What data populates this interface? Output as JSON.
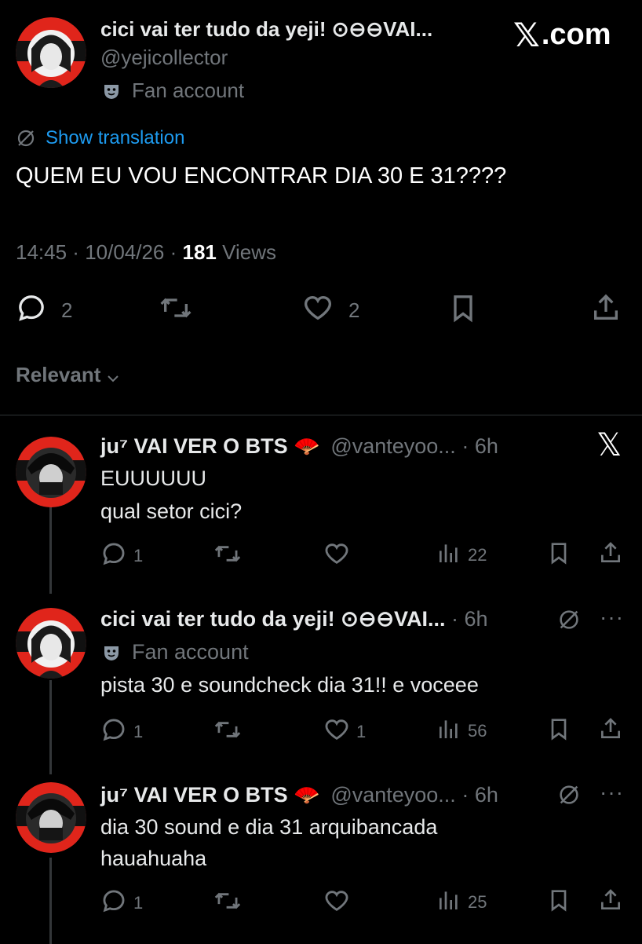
{
  "watermark": "X.com",
  "main_post": {
    "display_name": "cici vai ter tudo da yeji! ⊙⊖⊖VAI...",
    "handle": "@yejicollector",
    "badge": "Fan account",
    "translate_label": "Show translation",
    "text": "QUEM EU VOU ENCONTRAR DIA 30 E 31????",
    "time": "14:45",
    "date": "10/04/26",
    "views_count": "181",
    "views_label": "Views",
    "replies": "2",
    "likes": "2"
  },
  "sort_label": "Relevant",
  "replies": [
    {
      "display_name": "ju⁷ VAI VER O BTS 🪭",
      "handle": "@vanteyoo...",
      "time": "6h",
      "lines": [
        "EUUUUUU",
        "qual setor cici?"
      ],
      "reply_count": "1",
      "like_count": "",
      "view_count": "22"
    },
    {
      "display_name": "cici vai ter tudo da yeji! ⊙⊖⊖VAI...",
      "time": "6h",
      "badge": "Fan account",
      "lines": [
        "pista 30 e soundcheck dia 31!! e voceee"
      ],
      "reply_count": "1",
      "like_count": "1",
      "view_count": "56"
    },
    {
      "display_name": "ju⁷ VAI VER O BTS 🪭",
      "handle": "@vanteyoo...",
      "time": "6h",
      "lines": [
        "dia 30 sound e dia 31 arquibancada",
        "hauahuaha"
      ],
      "reply_count": "1",
      "like_count": "",
      "view_count": "25"
    }
  ],
  "colors": {
    "background": "#000000",
    "text": "#e7e9ea",
    "muted": "#71767b",
    "link": "#1d9bf0",
    "avatar_red": "#e0251b"
  }
}
